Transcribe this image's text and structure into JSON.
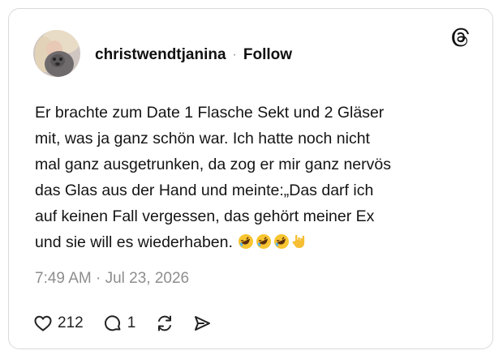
{
  "post": {
    "username": "christwendtjanina",
    "separator": "·",
    "follow_label": "Follow",
    "text": "Er brachte zum Date 1 Flasche Sekt und 2 Gläser\nmit, was ja ganz schön war. Ich hatte noch nicht\nmal ganz ausgetrunken, da zog er mir ganz nervös\ndas Glas aus der Hand und meinte:„Das darf ich\nauf keinen Fall vergessen, das gehört meiner Ex\nund sie will es wiederhaben.",
    "emojis": [
      "rolling-on-floor-laughing",
      "rolling-on-floor-laughing",
      "rolling-on-floor-laughing",
      "love-you-gesture"
    ],
    "timestamp": "7:49 AM · Jul 23, 2026"
  },
  "actions": {
    "likes": "212",
    "replies": "1"
  },
  "icons": {
    "brand": "threads-logo-icon",
    "like": "heart-icon",
    "reply": "speech-bubble-icon",
    "repost": "repost-arrows-icon",
    "share": "send-icon"
  }
}
